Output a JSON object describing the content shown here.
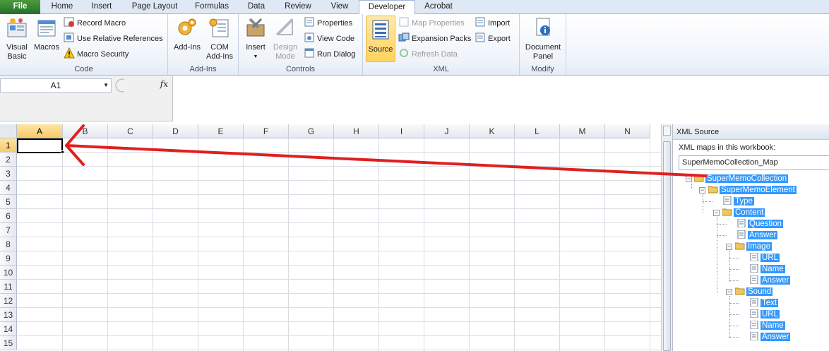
{
  "tabs": [
    {
      "label": "File"
    },
    {
      "label": "Home"
    },
    {
      "label": "Insert"
    },
    {
      "label": "Page Layout"
    },
    {
      "label": "Formulas"
    },
    {
      "label": "Data"
    },
    {
      "label": "Review"
    },
    {
      "label": "View"
    },
    {
      "label": "Developer"
    },
    {
      "label": "Acrobat"
    }
  ],
  "ribbon": {
    "code": {
      "label": "Code",
      "visual_basic": "Visual Basic",
      "macros": "Macros",
      "record_macro": "Record Macro",
      "relative_refs": "Use Relative References",
      "macro_security": "Macro Security"
    },
    "addins": {
      "label": "Add-Ins",
      "addins": "Add-Ins",
      "com_addins": "COM Add-Ins"
    },
    "controls": {
      "label": "Controls",
      "insert": "Insert",
      "design_mode": "Design Mode",
      "properties": "Properties",
      "view_code": "View Code",
      "run_dialog": "Run Dialog"
    },
    "xml": {
      "label": "XML",
      "source": "Source",
      "map_properties": "Map Properties",
      "expansion_packs": "Expansion Packs",
      "refresh_data": "Refresh Data",
      "import": "Import",
      "export": "Export"
    },
    "modify": {
      "label": "Modify",
      "document_panel": "Document Panel"
    }
  },
  "formula_bar": {
    "name_box": "A1",
    "fx": "fx",
    "value": ""
  },
  "sheet": {
    "columns": [
      "A",
      "B",
      "C",
      "D",
      "E",
      "F",
      "G",
      "H",
      "I",
      "J",
      "K",
      "L",
      "M",
      "N"
    ],
    "rows": [
      "1",
      "2",
      "3",
      "4",
      "5",
      "6",
      "7",
      "8",
      "9",
      "10",
      "11",
      "12",
      "13",
      "14",
      "15"
    ],
    "active_cell": "A1"
  },
  "xml_source": {
    "title": "XML Source",
    "maps_label": "XML maps in this workbook:",
    "selected_map": "SuperMemoCollection_Map",
    "tree": {
      "root": "SuperMemoCollection",
      "element": "SuperMemoElement",
      "type": "Type",
      "content": "Content",
      "question": "Question",
      "answer": "Answer",
      "image": "Image",
      "image_url": "URL",
      "image_name": "Name",
      "image_answer": "Answer",
      "sound": "Sound",
      "sound_text": "Text",
      "sound_url": "URL",
      "sound_name": "Name",
      "sound_answer": "Answer"
    }
  },
  "colors": {
    "file_tab": "#2f7d32",
    "selection": "#3399ff",
    "arrow": "#e02020",
    "active_header": "#f9c96a"
  }
}
